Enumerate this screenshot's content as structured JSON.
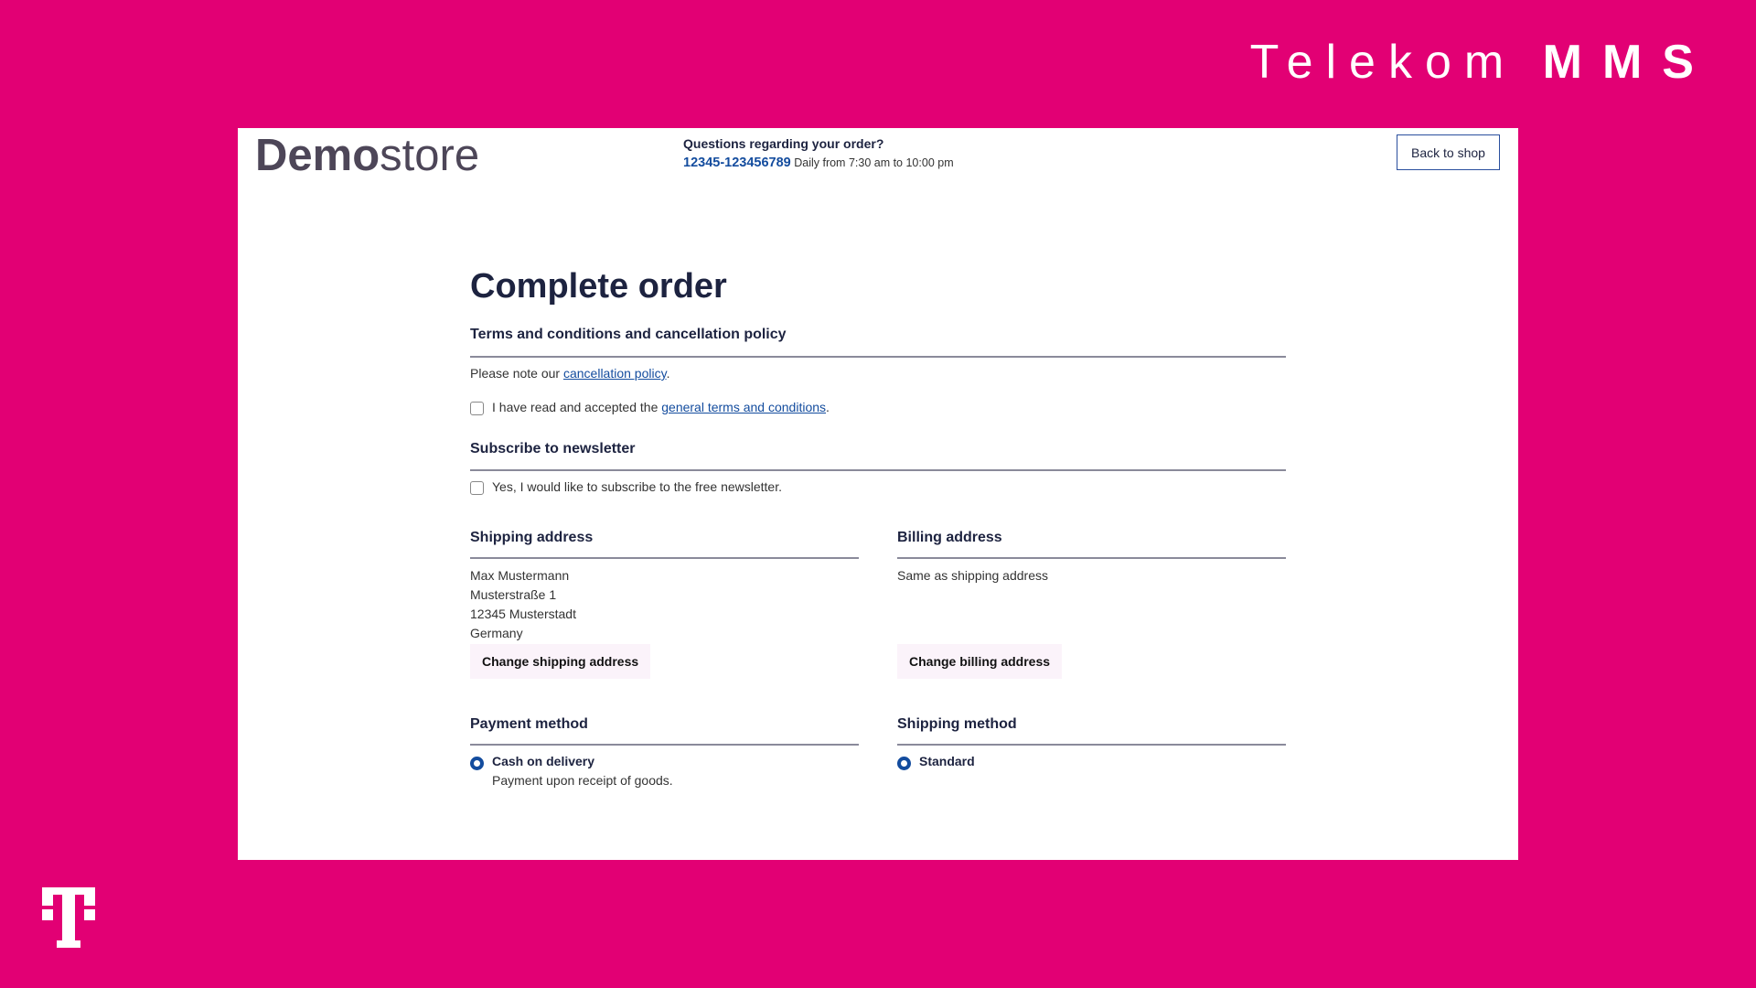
{
  "brand": {
    "name": "Telekom",
    "suffix": "MMS",
    "logo_letter": "T"
  },
  "colors": {
    "background": "#e20074",
    "link": "#134c9e",
    "text": "#1d2340"
  },
  "header": {
    "logo_bold": "Demo",
    "logo_light": "store",
    "question": "Questions regarding your order?",
    "phone": "12345-123456789",
    "hours": "Daily from 7:30 am to 10:00 pm",
    "back_button": "Back to shop"
  },
  "main": {
    "title": "Complete order",
    "terms": {
      "heading": "Terms and conditions and cancellation policy",
      "note_prefix": "Please note our ",
      "note_link": "cancellation policy",
      "note_suffix": ".",
      "checkbox_prefix": "I have read and accepted the ",
      "checkbox_link": "general terms and conditions",
      "checkbox_suffix": ".",
      "checked": false
    },
    "newsletter": {
      "heading": "Subscribe to newsletter",
      "checkbox_label": "Yes, I would like to subscribe to the free newsletter.",
      "checked": false
    },
    "shipping_address": {
      "heading": "Shipping address",
      "lines": [
        "Max Mustermann",
        "Musterstraße 1",
        "12345 Musterstadt",
        "Germany"
      ],
      "button": "Change shipping address"
    },
    "billing_address": {
      "heading": "Billing address",
      "text": "Same as shipping address",
      "button": "Change billing address"
    },
    "payment": {
      "heading": "Payment method",
      "selected": "Cash on delivery",
      "description": "Payment upon receipt of goods."
    },
    "shipping_method": {
      "heading": "Shipping method",
      "selected": "Standard"
    }
  }
}
